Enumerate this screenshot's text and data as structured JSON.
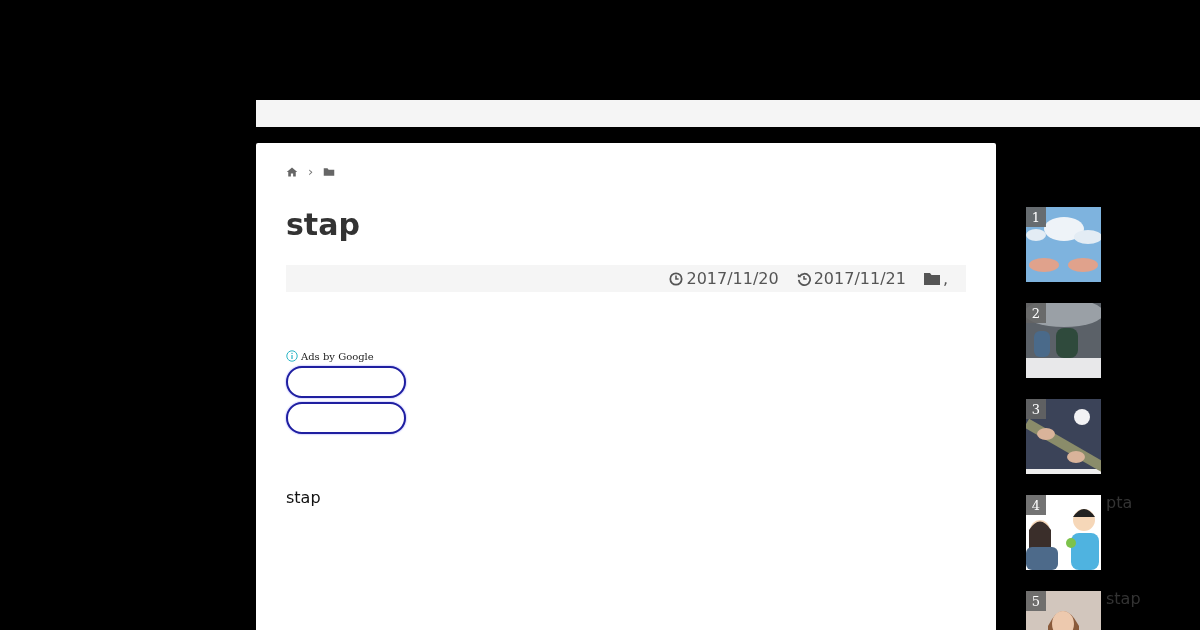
{
  "breadcrumb": {
    "separator": "›"
  },
  "article": {
    "title": "stap",
    "published": "2017/11/20",
    "updated": "2017/11/21",
    "categories": ",",
    "body": "stap"
  },
  "ads": {
    "label": "Ads by Google",
    "buttons": [
      {
        "kind": "outline"
      },
      {
        "kind": "outline"
      }
    ]
  },
  "ranking": [
    {
      "rank": "1",
      "kind": "picture"
    },
    {
      "rank": "2",
      "kind": "picture"
    },
    {
      "rank": "3",
      "kind": "picture"
    },
    {
      "rank": "4",
      "title": "pta",
      "kind": "picture"
    },
    {
      "rank": "5",
      "title": "stap",
      "kind": "picture"
    }
  ]
}
